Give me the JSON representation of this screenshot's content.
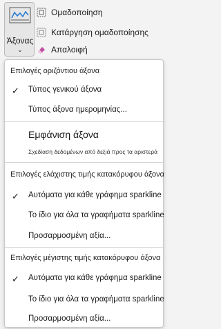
{
  "ribbon": {
    "axis_button_label": "Άξονας",
    "group_label": "Ομαδοποίηση",
    "ungroup_label": "Κατάργηση ομαδοποίησης",
    "clear_label": "Απαλοιφή"
  },
  "menu": {
    "horizontal": {
      "title": "Επιλογές οριζόντιου άξονα",
      "general_axis": "Τύπος γενικού άξονα",
      "date_axis": "Τύπος άξονα ημερομηνίας...",
      "show_axis": "Εμφάνιση άξονα",
      "rtl_note": "Σχεδίαση δεδομένων από δεξιά προς τα αριστερά"
    },
    "vertical_min": {
      "title": "Επιλογές ελάχιστης τιμής κατακόρυφου άξονα",
      "auto": "Αυτόματα για κάθε γράφημα sparkline",
      "same": "Το ίδιο για όλα τα γραφήματα sparkline",
      "custom": "Προσαρμοσμένη αξία..."
    },
    "vertical_max": {
      "title": "Επιλογές μέγιστης τιμής κατακόρυφου άξονα",
      "auto": "Αυτόματα για κάθε γράφημα sparkline",
      "same": "Το ίδιο για όλα τα γραφήματα sparkline",
      "custom": "Προσαρμοσμένη αξία..."
    },
    "check_glyph": "✓"
  }
}
